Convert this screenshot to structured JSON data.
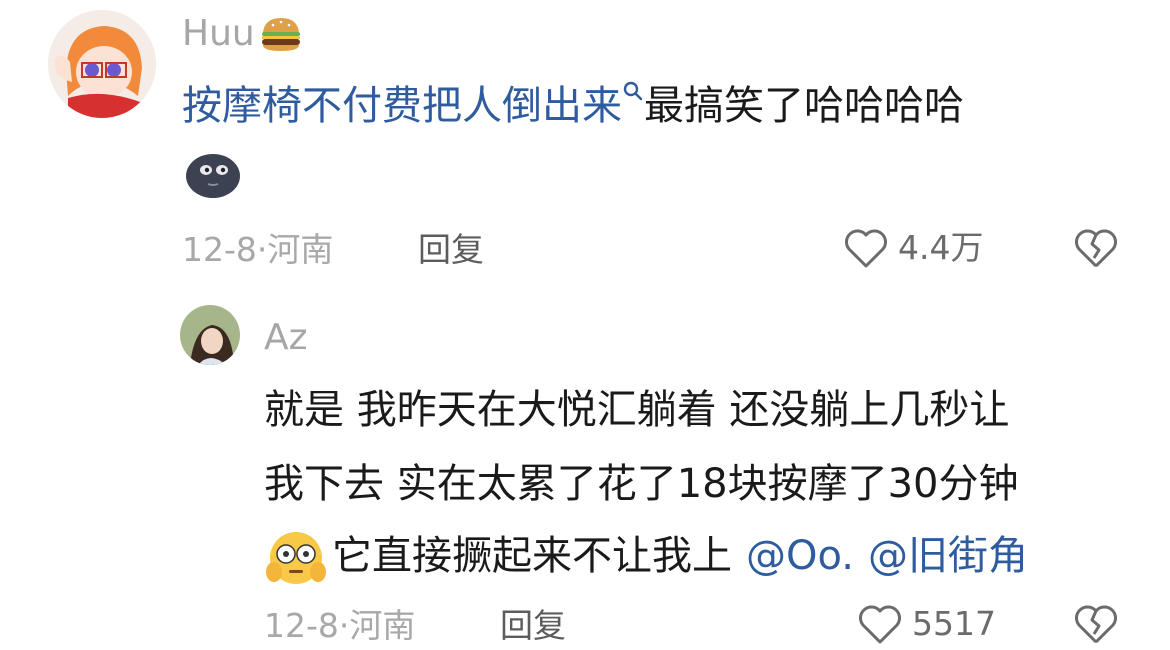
{
  "comment": {
    "author": "Huu",
    "author_emoji_icon": "hamburger-icon",
    "text_link": "按摩椅不付费把人倒出来",
    "text_rest": "最搞笑了哈哈哈哈",
    "sticker_icon": "dark-moon-face-icon",
    "date": "12-8",
    "location": "河南",
    "reply_label": "回复",
    "likes": "4.4万"
  },
  "reply": {
    "author": "Az",
    "line1": "就是 我昨天在大悦汇躺着 还没躺上几秒让",
    "line2": "我下去 实在太累了花了18块按摩了30分钟",
    "line3_text": "它直接撅起来不让我上",
    "line3_emoji_icon": "flushed-face-icon",
    "mention1": "@Oo.",
    "mention2": "@旧街角",
    "date": "12-8",
    "location": "河南",
    "reply_label": "回复",
    "likes": "5517"
  },
  "colors": {
    "link": "#2f5c9e",
    "meta": "#a8a8a8",
    "text": "#1a1a1a"
  }
}
